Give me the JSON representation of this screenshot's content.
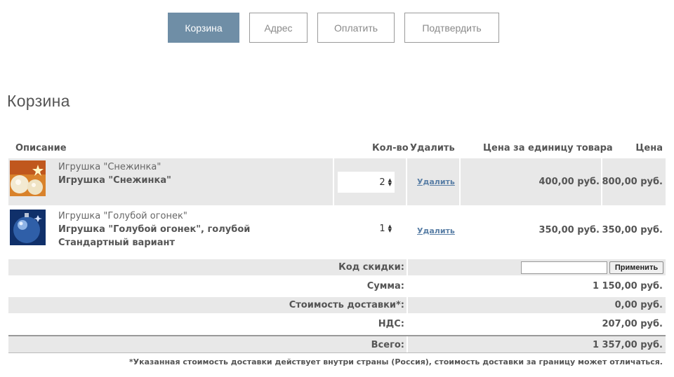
{
  "steps": [
    {
      "label": "Корзина",
      "active": true
    },
    {
      "label": "Адрес",
      "active": false
    },
    {
      "label": "Оплатить",
      "active": false
    },
    {
      "label": "Подтвердить",
      "active": false
    }
  ],
  "page_title": "Корзина",
  "table": {
    "headers": {
      "description": "Описание",
      "qty": "Кол-во",
      "remove": "Удалить",
      "unit_price": "Цена за единицу товара",
      "price": "Цена"
    },
    "items": [
      {
        "name": "Игрушка \"Снежинка\"",
        "title": "Игрушка \"Снежинка\"",
        "variant": "",
        "qty": "2",
        "remove_label": "Удалить",
        "unit_price": "400,00 руб.",
        "price": "800,00 руб.",
        "image_icon": "christmas-balls-image"
      },
      {
        "name": "Игрушка \"Голубой огонек\"",
        "title": "Игрушка \"Голубой огонек\", голубой",
        "variant": "Стандартный вариант",
        "qty": "1",
        "remove_label": "Удалить",
        "unit_price": "350,00 руб.",
        "price": "350,00 руб.",
        "image_icon": "blue-ornament-image"
      }
    ]
  },
  "summary": {
    "coupon_label": "Код скидки:",
    "coupon_value": "",
    "apply_label": "Применить",
    "subtotal_label": "Сумма:",
    "subtotal_value": "1 150,00 руб.",
    "shipping_label": "Стоимость доставки*:",
    "shipping_value": "0,00 руб.",
    "vat_label": "НДС:",
    "vat_value": "207,00 руб.",
    "total_label": "Всего:",
    "total_value": "1 357,00 руб."
  },
  "footnote": "*Указанная стоимость доставки действует внутри страны (Россия), стоимость доставки за границу может отличаться.",
  "colors": {
    "active_step": "#6f8ea6",
    "row_grey": "#e8e8e8",
    "link": "#5a7fa6"
  }
}
